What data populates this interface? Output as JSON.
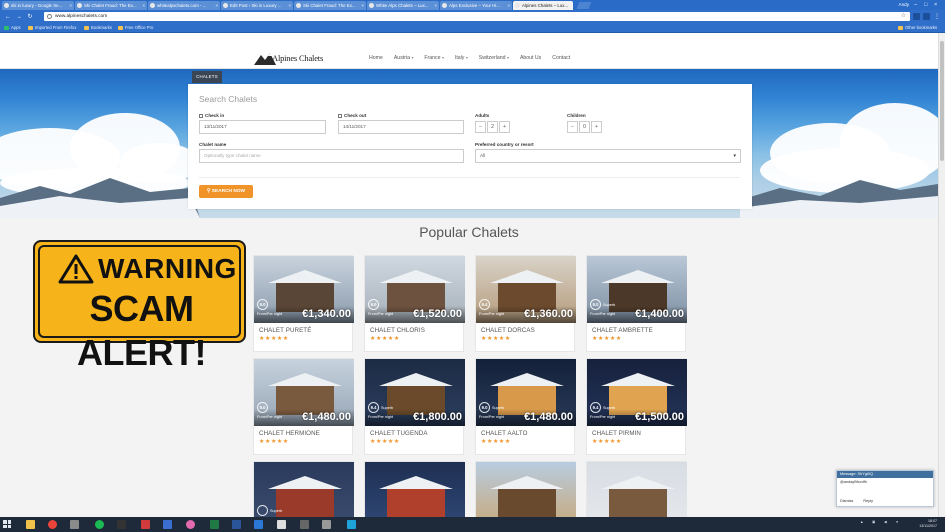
{
  "browser": {
    "tabs": [
      {
        "label": "ski in luxury - Google Se...",
        "active": false
      },
      {
        "label": "Ski Chalet Fraud: The Ex...",
        "active": false
      },
      {
        "label": "whitealpschalets.com - ...",
        "active": false
      },
      {
        "label": "Edit Post ‹ Ski in Luxury ...",
        "active": false
      },
      {
        "label": "Ski Chalet Fraud: The Ex...",
        "active": false
      },
      {
        "label": "White Alps Chalets – Lux...",
        "active": false
      },
      {
        "label": "Alps Exclusive – Your Hi...",
        "active": false
      },
      {
        "label": "Alpines Chalets – Lux...",
        "active": true
      }
    ],
    "user": "Andy",
    "url": "www.alpineschalets.com",
    "bookmarks": [
      "Apps",
      "Imported From Firefox",
      "Bookmarks",
      "Free Office Pro"
    ],
    "other_bookmarks": "Other bookmarks"
  },
  "site": {
    "logo": "Alpines Chalets",
    "nav": [
      "Home",
      "Austria",
      "France",
      "Italy",
      "Switzerland",
      "About Us",
      "Contact"
    ],
    "chalets_tab": "CHALETS",
    "search": {
      "title": "Search Chalets",
      "checkin_label": "Check in",
      "checkin_value": "13/11/2017",
      "checkout_label": "Check out",
      "checkout_value": "14/11/2017",
      "adults_label": "Adults",
      "adults_value": "2",
      "children_label": "Children",
      "children_value": "0",
      "chalet_name_label": "Chalet name",
      "chalet_name_placeholder": "Optionally type chalet name",
      "country_label": "Preferred country or resort",
      "country_value": "All",
      "button": "SEARCH NOW"
    },
    "popular_title": "Popular Chalets",
    "per_night": "From/Per night",
    "chalets": [
      {
        "name": "CHALET PURETÉ",
        "price": "€1,340.00",
        "score": "9.0",
        "word": ""
      },
      {
        "name": "CHALET CHLORIS",
        "price": "€1,520.00",
        "score": "9.0",
        "word": ""
      },
      {
        "name": "CHALET DORCAS",
        "price": "€1,360.00",
        "score": "9.4",
        "word": ""
      },
      {
        "name": "CHALET AMBRETTE",
        "price": "€1,400.00",
        "score": "9.0",
        "word": "Superb"
      },
      {
        "name": "CHALET HERMIONE",
        "price": "€1,480.00",
        "score": "9.0",
        "word": ""
      },
      {
        "name": "CHALET TUGENDA",
        "price": "€1,800.00",
        "score": "9.4",
        "word": "Superb"
      },
      {
        "name": "CHALET AALTO",
        "price": "€1,480.00",
        "score": "9.0",
        "word": "Superb"
      },
      {
        "name": "CHALET PIRMIN",
        "price": "€1,500.00",
        "score": "9.4",
        "word": "Superb"
      },
      {
        "name": "",
        "price": "",
        "score": "",
        "word": "Superb"
      },
      {
        "name": "",
        "price": "",
        "score": "",
        "word": ""
      },
      {
        "name": "",
        "price": "",
        "score": "",
        "word": ""
      },
      {
        "name": "",
        "price": "",
        "score": "",
        "word": ""
      }
    ]
  },
  "warning": {
    "line1": "WARNING",
    "line2": "SCAM ALERT!"
  },
  "message_popup": {
    "title": "Message: ShYgt0Q",
    "body": "@andayBfcxdfh",
    "dismiss": "Dismiss",
    "reply": "Reply"
  },
  "taskbar": {
    "time": "18:07",
    "date": "13/11/2017"
  },
  "colors": {
    "accent": "#f0942a",
    "tab_dark": "#3a4654",
    "browser_blue": "#2f6fc9",
    "warning_yellow": "#f6b31a"
  }
}
